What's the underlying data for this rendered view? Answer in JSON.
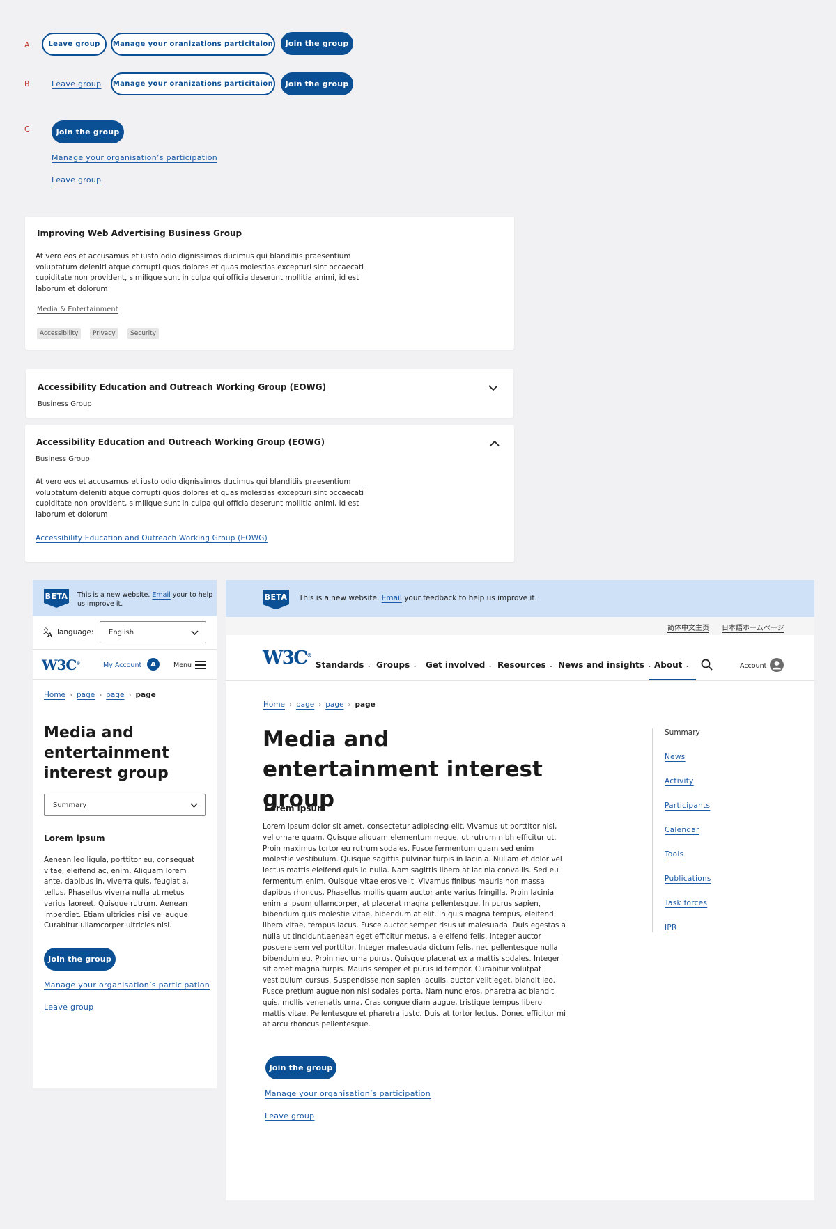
{
  "variants": {
    "a": {
      "letter": "A",
      "leave": "Leave group",
      "manage": "Manage your oranizations particitaion",
      "join": "Join the group"
    },
    "b": {
      "letter": "B",
      "leave": "Leave group",
      "manage": "Manage your oranizations particitaion",
      "join": "Join the group"
    },
    "c": {
      "letter": "C",
      "join": "Join the group",
      "manage": "Manage your organisation’s participation",
      "leave": "Leave group"
    }
  },
  "card1": {
    "title": "Improving Web Advertising Business Group",
    "body": "At vero eos et accusamus et iusto odio dignissimos ducimus qui blanditiis praesentium voluptatum deleniti atque corrupti quos dolores et quas molestias excepturi sint occaecati cupiditate non provident, similique sunt in culpa qui officia deserunt mollitia animi, id est laborum et dolorum",
    "category": "Media & Entertainment",
    "tags": [
      "Accessibility",
      "Privacy",
      "Security"
    ]
  },
  "accordion_collapsed": {
    "title": "Accessibility Education and Outreach Working Group (EOWG)",
    "subtitle": "Business Group"
  },
  "accordion_expanded": {
    "title": "Accessibility Education and Outreach Working Group (EOWG)",
    "subtitle": "Business Group",
    "body": "At vero eos et accusamus et iusto odio dignissimos ducimus qui blanditiis praesentium voluptatum deleniti atque corrupti quos dolores et quas molestias excepturi sint occaecati cupiditate non provident, similique sunt in culpa qui officia deserunt mollitia animi, id est laborum et dolorum",
    "link": "Accessibility Education and Outreach Working Group (EOWG)"
  },
  "mobile": {
    "beta_badge": "BETA",
    "beta_text_1": "This is a new website.",
    "beta_email": "Email",
    "beta_text_2": "your",
    "beta_text_3": "to help us improve it.",
    "language_label": "language:",
    "language_value": "English",
    "my_account": "My Account",
    "avatar_letter": "A",
    "menu": "Menu",
    "breadcrumb": [
      "Home",
      "page",
      "page",
      "page"
    ],
    "title": "Media and entertainment interest group",
    "summary_select": "Summary",
    "section_heading": "Lorem ipsum",
    "body": "Aenean leo ligula, porttitor eu, consequat vitae, eleifend ac, enim. Aliquam lorem ante, dapibus in, viverra quis, feugiat a, tellus. Phasellus viverra nulla ut metus varius laoreet. Quisque rutrum. Aenean imperdiet. Etiam ultricies nisi vel augue. Curabitur ullamcorper ultricies nisi.",
    "join": "Join the group",
    "manage": "Manage your organisation’s participation",
    "leave": "Leave group"
  },
  "desktop": {
    "beta_badge": "BETA",
    "beta_text_1": "This is a new website.",
    "beta_email": "Email",
    "beta_text_2": "your feedback to help us improve it.",
    "lang_links": [
      "简体中文主页",
      "日本語ホームページ"
    ],
    "nav": [
      "Standards",
      "Groups",
      "Get involved",
      "Resources",
      "News and insights",
      "About"
    ],
    "account": "Account",
    "breadcrumb": [
      "Home",
      "page",
      "page",
      "page"
    ],
    "title": "Media and entertainment interest group",
    "section_heading": "Lorem ipsum",
    "body": "Lorem ipsum dolor sit amet, consectetur adipiscing elit. Vivamus ut porttitor nisl, vel ornare quam. Quisque aliquam elementum neque, ut rutrum nibh efficitur ut. Proin maximus tortor eu rutrum sodales. Fusce fermentum quam sed enim molestie vestibulum. Quisque sagittis pulvinar turpis in lacinia. Nullam et dolor vel lectus mattis eleifend quis id nulla. Nam sagittis libero at lacinia convallis. Sed eu fermentum enim. Quisque vitae eros velit. Vivamus finibus mauris non massa dapibus rhoncus. Phasellus mollis quam auctor ante varius fringilla. Proin lacinia enim a ipsum ullamcorper, at placerat magna pellentesque. In purus sapien, bibendum quis molestie vitae, bibendum at elit. In quis magna tempus, eleifend libero vitae, tempus lacus. Fusce auctor semper risus ut malesuada. Duis egestas a nulla ut tincidunt.aenean eget efficitur metus, a eleifend felis. Integer auctor posuere sem vel porttitor. Integer malesuada dictum felis, nec pellentesque nulla bibendum eu. Proin nec urna purus. Quisque placerat ex a mattis sodales. Integer sit amet magna turpis. Mauris semper et purus id tempor. Curabitur volutpat vestibulum cursus. Suspendisse non sapien iaculis, auctor velit eget, blandit leo. Fusce pretium augue non nisi sodales porta. Nam nunc eros, pharetra ac blandit quis, mollis venenatis urna. Cras congue diam augue, tristique tempus libero mattis vitae. Pellentesque et pharetra justo. Duis at tortor lectus. Donec efficitur mi at arcu rhoncus pellentesque.",
    "toc_heading": "Summary",
    "toc": [
      "News",
      "Activity",
      "Participants",
      "Calendar",
      "Tools",
      "Publications",
      "Task forces",
      "IPR"
    ],
    "join": "Join the group",
    "manage": "Manage your organisation’s participation",
    "leave": "Leave group"
  },
  "colors": {
    "primary": "#0b4f94",
    "link": "#1b5aa6",
    "beta_bg": "#cfe1f7",
    "canvas": "#f1f1f3",
    "variant_letter": "#c0392b"
  }
}
